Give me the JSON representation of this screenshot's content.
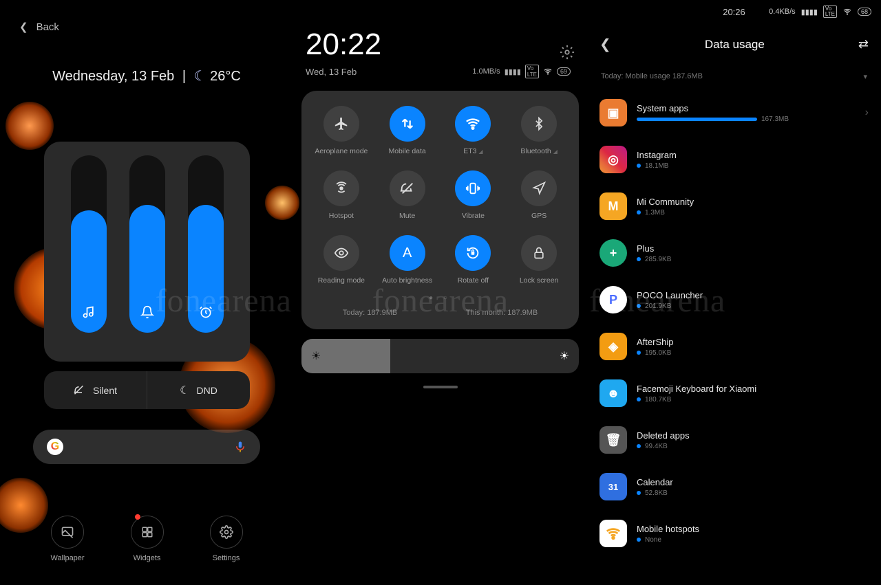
{
  "watermark": "fonearena",
  "pane1": {
    "back": "Back",
    "weather": "Wednesday, 13 Feb",
    "temp": "26°C",
    "sliders": [
      {
        "name": "music",
        "fill": 69
      },
      {
        "name": "ring",
        "fill": 72
      },
      {
        "name": "alarm",
        "fill": 72
      }
    ],
    "silent": "Silent",
    "dnd": "DND",
    "edit": {
      "wallpaper": "Wallpaper",
      "widgets": "Widgets",
      "settings": "Settings"
    }
  },
  "pane2": {
    "clock": "20:22",
    "date": "Wed, 13 Feb",
    "speed": "1.0MB/s",
    "battery": "69",
    "toggles": [
      {
        "label": "Aeroplane mode",
        "on": false,
        "icon": "✈"
      },
      {
        "label": "Mobile data",
        "on": true,
        "icon": "⇅"
      },
      {
        "label": "ET3",
        "on": true,
        "icon": "wifi",
        "chev": true
      },
      {
        "label": "Bluetooth",
        "on": false,
        "icon": "bt",
        "chev": true
      },
      {
        "label": "Hotspot",
        "on": false,
        "icon": "hot"
      },
      {
        "label": "Mute",
        "on": false,
        "icon": "mute"
      },
      {
        "label": "Vibrate",
        "on": true,
        "icon": "vib"
      },
      {
        "label": "GPS",
        "on": false,
        "icon": "gps"
      },
      {
        "label": "Reading mode",
        "on": false,
        "icon": "read"
      },
      {
        "label": "Auto brightness",
        "on": true,
        "icon": "A"
      },
      {
        "label": "Rotate off",
        "on": true,
        "icon": "rot"
      },
      {
        "label": "Lock screen",
        "on": false,
        "icon": "lock"
      }
    ],
    "usage": {
      "today": "Today: 187.9MB",
      "month": "This month: 187.9MB"
    }
  },
  "pane3": {
    "time": "20:26",
    "speed": "0.4KB/s",
    "battery": "68",
    "title": "Data usage",
    "today": "Today: Mobile usage 187.6MB",
    "apps": [
      {
        "name": "System apps",
        "size": "167.3MB",
        "bar": 175,
        "color": "#ea7b31",
        "glyph": "▣",
        "chev": true
      },
      {
        "name": "Instagram",
        "size": "18.1MB",
        "bar": 0,
        "color": "linear-gradient(45deg,#f09433,#e6683c,#dc2743,#cc2366,#bc1888)",
        "glyph": "◎"
      },
      {
        "name": "Mi Community",
        "size": "1.3MB",
        "bar": 0,
        "color": "#f5a623",
        "glyph": "M"
      },
      {
        "name": "Plus",
        "size": "285.9KB",
        "bar": 0,
        "color": "#1aa878",
        "glyph": "+",
        "round": true
      },
      {
        "name": "POCO Launcher",
        "size": "201.9KB",
        "bar": 0,
        "color": "#ffffff",
        "glyph": "P",
        "round": true,
        "textcolor": "#4a6bff"
      },
      {
        "name": "AfterShip",
        "size": "195.0KB",
        "bar": 0,
        "color": "#f39c12",
        "glyph": "◈"
      },
      {
        "name": "Facemoji Keyboard for Xiaomi",
        "size": "180.7KB",
        "bar": 0,
        "color": "#1fa8f0",
        "glyph": "☻"
      },
      {
        "name": "Deleted apps",
        "size": "99.4KB",
        "bar": 0,
        "color": "#555",
        "glyph": "🗑"
      },
      {
        "name": "Calendar",
        "size": "52.8KB",
        "bar": 0,
        "color": "#2f6fe0",
        "glyph": "31"
      },
      {
        "name": "Mobile hotspots",
        "size": "None",
        "bar": 0,
        "color": "#ffffff",
        "glyph": "wifi-y"
      }
    ]
  }
}
